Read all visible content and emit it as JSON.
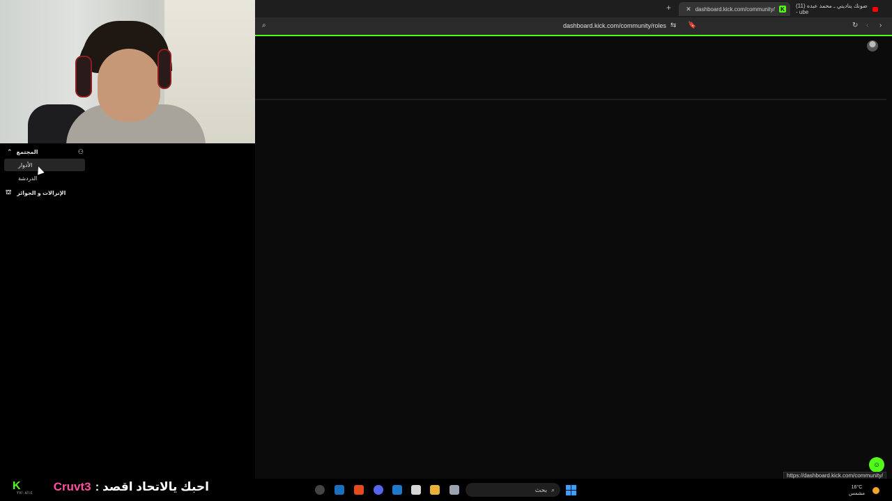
{
  "browser": {
    "tabs": [
      {
        "label": "dashboard.kick.com/community/",
        "active": true
      },
      {
        "label": "(11) ضونك يناديني ـ محمد عبده - ube",
        "active": false
      }
    ],
    "new_tab": "+",
    "url": "dashboard.kick.com/community/roles"
  },
  "sidebar": {
    "section_title": "المجتمع",
    "items": [
      {
        "label": "الأدوار",
        "active": true
      },
      {
        "label": "الدردشة",
        "active": false
      }
    ],
    "sub_section": "الإنزالات و الجوائز"
  },
  "status_url": "https://dashboard.kick.com/community/",
  "taskbar": {
    "ticker_user": "Cruvt3",
    "ticker_text": "احبك يالاتحاد اقصد :",
    "search_placeholder": "بحث",
    "weather_temp": "16°C",
    "weather_desc": "مشمس",
    "date_left": "٢٧/٠٨/١٤"
  },
  "colors": {
    "accent": "#53fc18",
    "bg": "#0b0b0b"
  }
}
